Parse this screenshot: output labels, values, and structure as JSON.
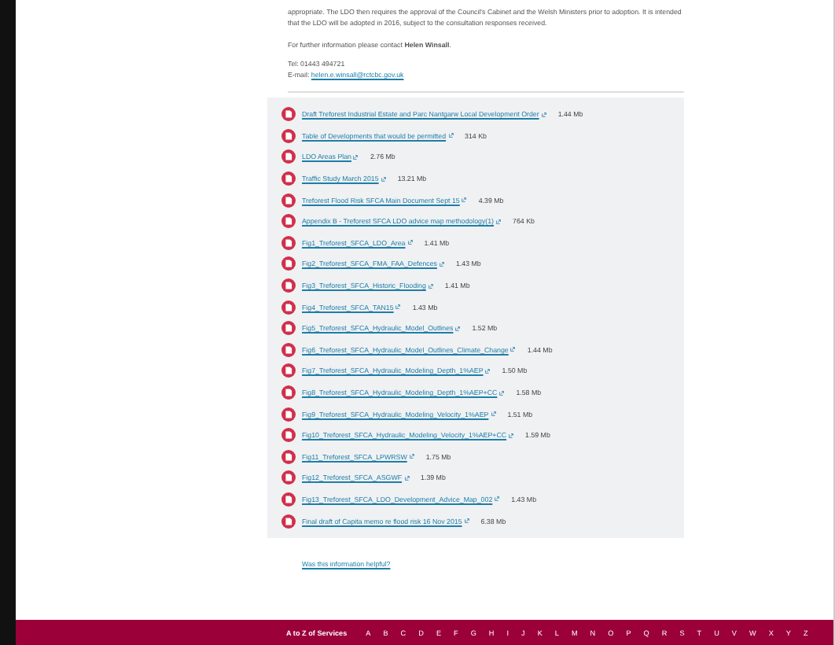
{
  "intro": {
    "paragraph": "appropriate. The LDO then requires the approval of the Council's Cabinet and the Welsh Ministers prior to adoption. It is intended that the LDO will be adopted in 2016, subject to the consultation responses received.",
    "contact_text": "For further information please contact **Helen Winsall**.",
    "tel": "Tel: 01443 494721",
    "email_label": "E-mail:",
    "email": "helen.e.winsall@rctcbc.gov.uk"
  },
  "documents": [
    {
      "name": "Draft Treforest Industrial Estate and Parc Nantgarw Local Development Order",
      "size": "1.44 Mb"
    },
    {
      "name": "Table of Developments that would be permitted",
      "size": "314 Kb"
    },
    {
      "name": "LDO Areas Plan",
      "size": "2.76 Mb"
    },
    {
      "name": "Traffic Study March 2015",
      "size": "13.21 Mb"
    },
    {
      "name": "Treforest Flood Risk SFCA Main Document Sept 15",
      "size": "4.39 Mb"
    },
    {
      "name": "Appendix B - Treforest SFCA LDO advice map methodology(1)",
      "size": "764 Kb"
    },
    {
      "name": "Fig1_Treforest_SFCA_LDO_Area",
      "size": "1.41 Mb"
    },
    {
      "name": "Fig2_Treforest_SFCA_FMA_FAA_Defences",
      "size": "1.43 Mb"
    },
    {
      "name": "Fig3_Treforest_SFCA_Historic_Flooding",
      "size": "1.41 Mb"
    },
    {
      "name": "Fig4_Treforest_SFCA_TAN15",
      "size": "1.43 Mb"
    },
    {
      "name": "Fig5_Treforest_SFCA_Hydraulic_Model_Outlines",
      "size": "1.52 Mb"
    },
    {
      "name": "Fig6_Treforest_SFCA_Hydraulic_Model_Outlines_Climate_Change",
      "size": "1.44 Mb"
    },
    {
      "name": "Fig7_Treforest_SFCA_Hydraulic_Modeling_Depth_1%AEP",
      "size": "1.50 Mb"
    },
    {
      "name": "Fig8_Treforest_SFCA_Hydraulic_Modeling_Depth_1%AEP+CC",
      "size": "1.58 Mb"
    },
    {
      "name": "Fig9_Treforest_SFCA_Hydraulic_Modeling_Velocity_1%AEP",
      "size": "1.51 Mb"
    },
    {
      "name": "Fig10_Treforest_SFCA_Hydraulic_Modeling_Velocity_1%AEP+CC",
      "size": "1.59 Mb"
    },
    {
      "name": "Fig11_Treforest_SFCA_LPWRSW",
      "size": "1.75 Mb"
    },
    {
      "name": "Fig12_Treforest_SFCA_ASGWF",
      "size": "1.39 Mb"
    },
    {
      "name": "Fig13_Treforest_SFCA_LDO_Development_Advice_Map_002",
      "size": "1.43 Mb"
    },
    {
      "name": "Final draft of Capita memo re flood risk 16 Nov 2015",
      "size": "6.38 Mb"
    }
  ],
  "feedback_link": "Was this information helpful?",
  "footer": {
    "title": "A to Z of Services",
    "letters": [
      "A",
      "B",
      "C",
      "D",
      "E",
      "F",
      "G",
      "H",
      "I",
      "J",
      "K",
      "L",
      "M",
      "N",
      "O",
      "P",
      "Q",
      "R",
      "S",
      "T",
      "U",
      "V",
      "W",
      "X",
      "Y",
      "Z"
    ]
  }
}
